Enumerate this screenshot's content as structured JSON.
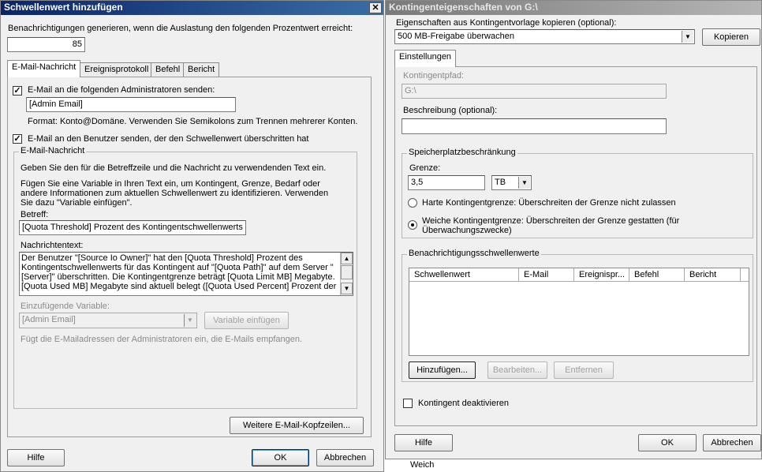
{
  "left": {
    "title": "Schwellenwert hinzufügen",
    "threshold_label": "Benachrichtigungen generieren, wenn die Auslastung den folgenden Prozentwert erreicht:",
    "threshold_value": "85",
    "tabs": [
      "E-Mail-Nachricht",
      "Ereignisprotokoll",
      "Befehl",
      "Bericht"
    ],
    "send_admin_label": "E-Mail an die folgenden Administratoren senden:",
    "admin_email_value": "[Admin Email]",
    "format_hint": "Format: Konto@Domäne. Verwenden Sie Semikolons zum Trennen mehrerer Konten.",
    "send_user_label": "E-Mail an den Benutzer senden, der den Schwellenwert überschritten hat",
    "group_title": "E-Mail-Nachricht",
    "intro_text": "Geben Sie den für die Betreffzeile und die Nachricht zu verwendenden Text ein.",
    "variable_text": "Fügen Sie eine Variable in Ihren Text ein, um Kontingent, Grenze, Bedarf oder andere Informationen zum aktuellen Schwellenwert zu identifizieren. Verwenden Sie dazu \"Variable einfügen\".",
    "subject_label": "Betreff:",
    "subject_value": "[Quota Threshold] Prozent des Kontingentschwellenwerts üb",
    "body_label": "Nachrichtentext:",
    "body_value": "Der Benutzer \"[Source Io Owner]\" hat den [Quota Threshold] Prozent des Kontingentschwellenwerts für das Kontingent auf \"[Quota Path]\" auf dem Server \"[Server]\" überschritten. Die Kontingentgrenze beträgt [Quota Limit MB] Megabyte. [Quota Used MB] Megabyte sind aktuell belegt ([Quota Used Percent] Prozent der",
    "insert_var_label": "Einzufügende Variable:",
    "insert_var_value": "[Admin Email]",
    "insert_var_button": "Variable einfügen",
    "insert_var_hint": "Fügt die E-Mailadressen der Administratoren ein, die E-Mails empfangen.",
    "more_headers_button": "Weitere E-Mail-Kopfzeilen...",
    "help_button": "Hilfe",
    "ok_button": "OK",
    "cancel_button": "Abbrechen"
  },
  "right": {
    "title": "Kontingenteigenschaften von G:\\",
    "copy_label": "Eigenschaften aus Kontingentvorlage kopieren (optional):",
    "template_value": "500 MB-Freigabe überwachen",
    "copy_button": "Kopieren",
    "tab": "Einstellungen",
    "path_label": "Kontingentpfad:",
    "path_value": "G:\\",
    "desc_label": "Beschreibung (optional):",
    "desc_value": "",
    "space_group": "Speicherplatzbeschränkung",
    "limit_label": "Grenze:",
    "limit_value": "3,5",
    "unit_value": "TB",
    "hard_label": "Harte Kontingentgrenze: Überschreiten der Grenze nicht zulassen",
    "soft_label": "Weiche Kontingentgrenze: Überschreiten der Grenze gestatten (für Überwachungszwecke)",
    "notif_group": "Benachrichtigungsschwellenwerte",
    "columns": [
      "Schwellenwert",
      "E-Mail",
      "Ereignispr...",
      "Befehl",
      "Bericht"
    ],
    "add_button": "Hinzufügen...",
    "edit_button": "Bearbeiten...",
    "remove_button": "Entfernen",
    "disable_label": "Kontingent deaktivieren",
    "help_button": "Hilfe",
    "ok_button": "OK",
    "cancel_button": "Abbrechen"
  },
  "bottom_text": "Weich"
}
